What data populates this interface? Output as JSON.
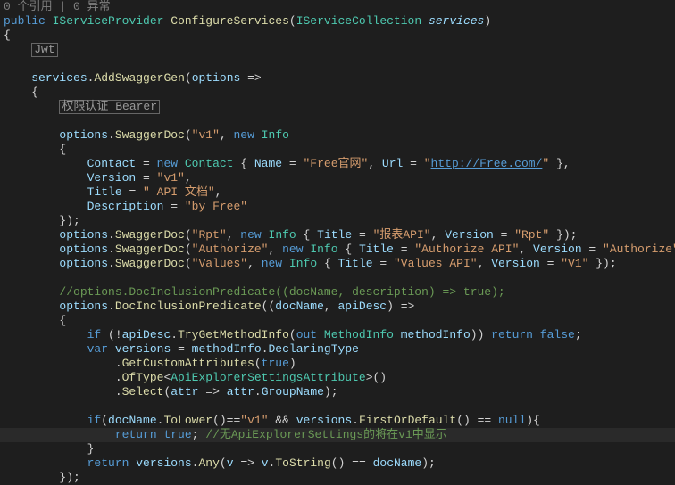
{
  "header": {
    "references_exceptions": "0 个引用 | 0 异常"
  },
  "tokens": {
    "kw_public": "public",
    "kw_new": "new",
    "kw_var": "var",
    "kw_if": "if",
    "kw_return": "return",
    "kw_true": "true",
    "kw_false": "false",
    "kw_null": "null",
    "kw_out": "out"
  },
  "types": {
    "IServiceProvider": "IServiceProvider",
    "IServiceCollection": "IServiceCollection",
    "Info": "Info",
    "Contact": "Contact",
    "MethodInfo": "MethodInfo",
    "ApiExplorerSettingsAttribute": "ApiExplorerSettingsAttribute"
  },
  "method_name": "ConfigureServices",
  "param_name": "services",
  "lens": {
    "jwt": "Jwt",
    "bearer": "权限认证 Bearer"
  },
  "calls": {
    "AddSwaggerGen": "AddSwaggerGen",
    "SwaggerDoc": "SwaggerDoc",
    "DocInclusionPredicate": "DocInclusionPredicate",
    "TryGetMethodInfo": "TryGetMethodInfo",
    "GetCustomAttributes": "GetCustomAttributes",
    "OfType": "OfType",
    "Select": "Select",
    "ToLower": "ToLower",
    "FirstOrDefault": "FirstOrDefault",
    "Any": "Any",
    "ToString": "ToString"
  },
  "vars": {
    "options": "options",
    "services": "services",
    "docName": "docName",
    "apiDesc": "apiDesc",
    "description": "description",
    "methodInfo": "methodInfo",
    "versions": "versions",
    "attr": "attr",
    "v": "v",
    "DeclaringType": "DeclaringType",
    "GroupName": "GroupName"
  },
  "props": {
    "Contact": "Contact",
    "Name": "Name",
    "Url": "Url",
    "Version": "Version",
    "Title": "Title",
    "Description": "Description"
  },
  "strings": {
    "v1": "\"v1\"",
    "free_name": "\"Free官网\"",
    "free_url": "\"http://Free.com/\"",
    "version_v1": "\"v1\"",
    "api_doc": "\" API 文档\"",
    "by_free": "\"by Free\"",
    "rpt": "\"Rpt\"",
    "rpt_title": "\"报表API\"",
    "rpt_version": "\"Rpt\"",
    "authorize": "\"Authorize\"",
    "authorize_title": "\"Authorize API\"",
    "authorize_version": "\"Authorize\"",
    "values": "\"Values\"",
    "values_title": "\"Values API\"",
    "values_version": "\"V1\"",
    "v1_lower": "\"v1\""
  },
  "comments": {
    "predicate_comment": "//options.DocInclusionPredicate((docName, description) => true);",
    "no_explorer": "//无ApiExplorerSettings的将在v1中显示"
  }
}
